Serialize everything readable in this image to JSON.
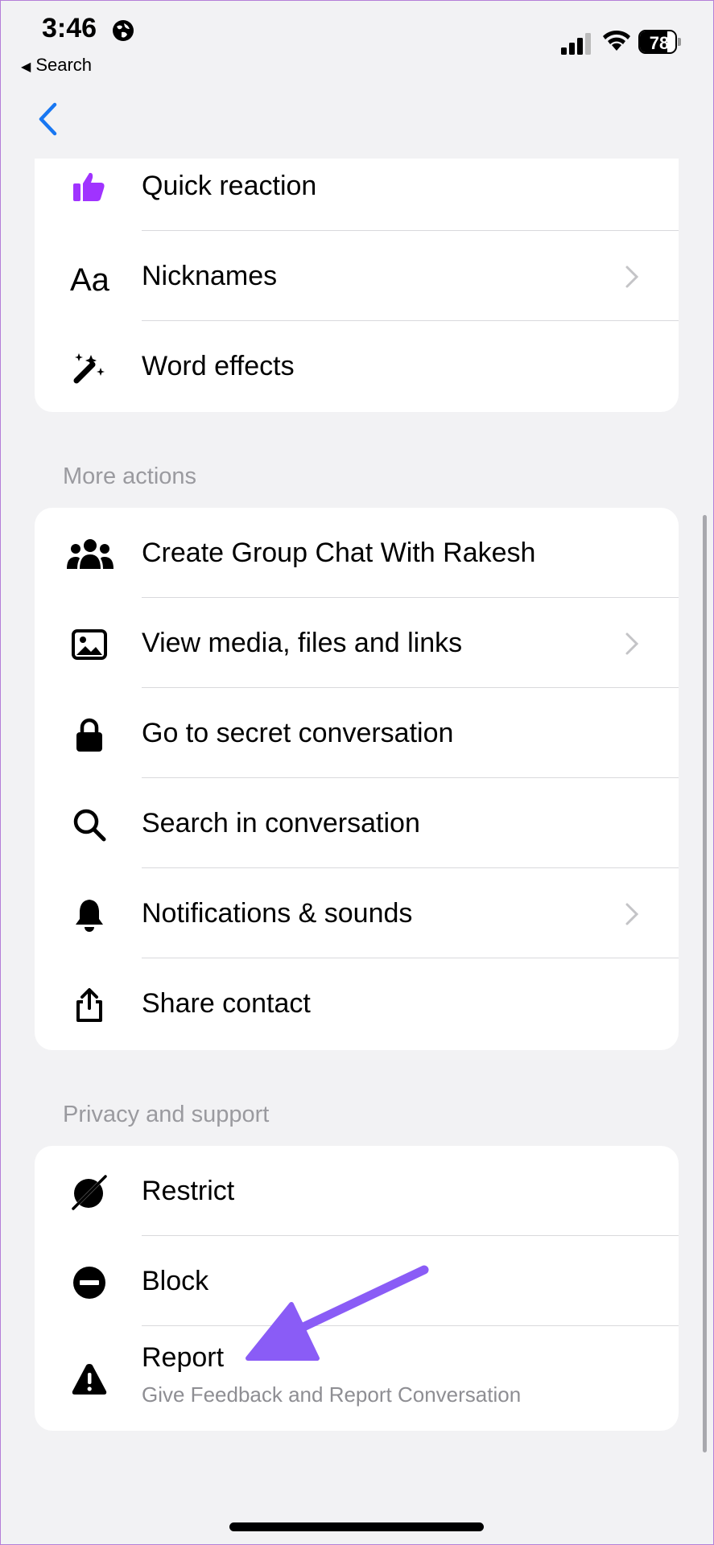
{
  "status": {
    "time": "3:46",
    "back_app": "Search",
    "battery": "78",
    "battery_level": 0.78
  },
  "cards": {
    "top": [
      {
        "label": "Quick reaction",
        "icon": "thumbs-up-icon",
        "chevron": false
      },
      {
        "label": "Nicknames",
        "icon": "text-aa-icon",
        "chevron": true
      },
      {
        "label": "Word effects",
        "icon": "magic-wand-icon",
        "chevron": false
      }
    ],
    "more_actions": {
      "title": "More actions",
      "items": [
        {
          "label": "Create Group Chat With Rakesh",
          "icon": "group-icon",
          "chevron": false
        },
        {
          "label": "View media, files and links",
          "icon": "image-icon",
          "chevron": true
        },
        {
          "label": "Go to secret conversation",
          "icon": "lock-icon",
          "chevron": false
        },
        {
          "label": "Search in conversation",
          "icon": "search-icon",
          "chevron": false
        },
        {
          "label": "Notifications & sounds",
          "icon": "bell-icon",
          "chevron": true
        },
        {
          "label": "Share contact",
          "icon": "share-icon",
          "chevron": false
        }
      ]
    },
    "privacy": {
      "title": "Privacy and support",
      "items": [
        {
          "label": "Restrict",
          "icon": "restrict-icon"
        },
        {
          "label": "Block",
          "icon": "block-icon"
        },
        {
          "label": "Report",
          "sublabel": "Give Feedback and Report Conversation",
          "icon": "warning-icon"
        }
      ]
    }
  },
  "colors": {
    "accent": "#1877f2",
    "reaction": "#a033ff",
    "annotation_arrow": "#8a5cf6",
    "background": "#f2f2f4"
  }
}
